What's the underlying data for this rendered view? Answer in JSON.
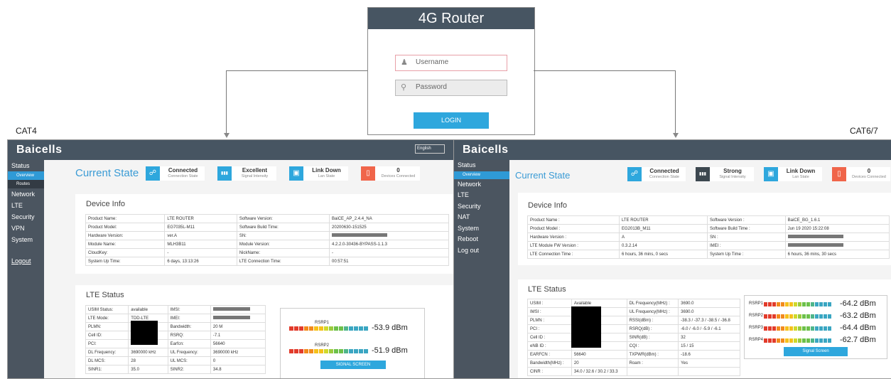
{
  "login": {
    "title": "4G Router",
    "username_placeholder": "Username",
    "password_placeholder": "Password",
    "login_label": "LOGIN"
  },
  "labels": {
    "left": "CAT4",
    "right": "CAT6/7"
  },
  "cat4": {
    "logo": "Baicells",
    "language": "English",
    "nav": [
      {
        "label": "Status",
        "type": "main"
      },
      {
        "label": "Overview",
        "type": "active"
      },
      {
        "label": "Routes",
        "type": "dark"
      },
      {
        "label": "Network",
        "type": "main"
      },
      {
        "label": "LTE",
        "type": "main"
      },
      {
        "label": "Security",
        "type": "main"
      },
      {
        "label": "VPN",
        "type": "main"
      },
      {
        "label": "System",
        "type": "main"
      },
      {
        "label": "",
        "type": "gap"
      },
      {
        "label": "Logout",
        "type": "logout"
      }
    ],
    "title": "Current State",
    "kpis": [
      {
        "value": "Connected",
        "sub": "Connection State",
        "color": "#2ea7dd"
      },
      {
        "value": "Excellent",
        "sub": "Signal Intensity",
        "color": "#2ea7dd"
      },
      {
        "value": "Link Down",
        "sub": "Lan State",
        "color": "#2ea7dd"
      },
      {
        "value": "0",
        "sub": "Devices Connected",
        "color": "#f0654a"
      }
    ],
    "device_info": {
      "heading": "Device Info",
      "rows": [
        [
          "Product Name:",
          "LTE ROUTER",
          "Software Version:",
          "BaiCE_AP_2.4.4_NA"
        ],
        [
          "Product Model:",
          "EG7035L-M11",
          "Software Build Time:",
          "20200630-151525"
        ],
        [
          "Hardware Version:",
          "ver.A",
          "SN:",
          ""
        ],
        [
          "Module Name:",
          "MLH3B11",
          "Module Version:",
          "4.2.2.0-30436-BYPASS-1.1.3"
        ],
        [
          "CloudKey:",
          "-",
          "NickName:",
          "-"
        ],
        [
          "System Up Time:",
          "6 days, 13:13:26",
          "LTE Connection Time:",
          "00:57:51"
        ]
      ]
    },
    "lte_status": {
      "heading": "LTE Status",
      "rows": [
        [
          "USIM Status:",
          "available",
          "IMSI:",
          ""
        ],
        [
          "LTE Mode:",
          "TDD-LTE",
          "IMEI:",
          ""
        ],
        [
          "PLMN:",
          "",
          "Bandwidth:",
          "20 M"
        ],
        [
          "Cell ID:",
          "",
          "RSRQ:",
          "-7.1"
        ],
        [
          "PCI:",
          "",
          "Earfcn:",
          "56640"
        ],
        [
          "DL Frequency:",
          "3690000 kHz",
          "UL Frequency:",
          "3690000 kHz"
        ],
        [
          "DL MCS:",
          "28",
          "UL MCS:",
          "0"
        ],
        [
          "SINR1:",
          "35.0",
          "SINR2:",
          "34.8"
        ]
      ],
      "signals": [
        {
          "label": "RSRP1",
          "value": "-53.9 dBm",
          "level": 1.0
        },
        {
          "label": "RSRP2",
          "value": "-51.9 dBm",
          "level": 1.0
        }
      ],
      "button": "SIGNAL SCREEN"
    }
  },
  "cat6": {
    "logo": "Baicells",
    "nav": [
      {
        "label": "Status",
        "type": "main"
      },
      {
        "label": "Overview",
        "type": "active"
      },
      {
        "label": "Network",
        "type": "main"
      },
      {
        "label": "LTE",
        "type": "main"
      },
      {
        "label": "Security",
        "type": "main"
      },
      {
        "label": "NAT",
        "type": "main"
      },
      {
        "label": "System",
        "type": "main"
      },
      {
        "label": "Reboot",
        "type": "main"
      },
      {
        "label": "Log out",
        "type": "main"
      }
    ],
    "title": "Current State",
    "kpis": [
      {
        "value": "Connected",
        "sub": "Connection State",
        "color": "#2ea7dd"
      },
      {
        "value": "Strong",
        "sub": "Signal Intensity",
        "color": "#3c474f"
      },
      {
        "value": "Link Down",
        "sub": "Lan State",
        "color": "#2ea7dd"
      },
      {
        "value": "0",
        "sub": "Devices Connected",
        "color": "#f0654a"
      }
    ],
    "device_info": {
      "heading": "Device Info",
      "rows": [
        [
          "Product Name :",
          "LTE ROUTER",
          "Software Version :",
          "BaiCE_BG_1.6.1"
        ],
        [
          "Product Model :",
          "EG2013B_M11",
          "Software Build Time :",
          "Jun 19 2020 15:22:08"
        ],
        [
          "Hardware Version :",
          "A",
          "SN :",
          ""
        ],
        [
          "LTE Module FW Version :",
          "0.3.2.14",
          "IMEI :",
          ""
        ],
        [
          "LTE Connection Time :",
          "6 hours, 36 mins, 0 secs",
          "System Up Time :",
          "6 hours, 36 mins, 30 secs"
        ]
      ]
    },
    "lte_status": {
      "heading": "LTE Status",
      "rows": [
        [
          "USIM :",
          "Available",
          "DL Frequency(MHz) :",
          "3690.0"
        ],
        [
          "IMSI :",
          "",
          "UL Frequency(MHz) :",
          "3690.0"
        ],
        [
          "PLMN :",
          "",
          "RSSI(dBm) :",
          "-38.3 / -37.3 / -38.5 / -36.8"
        ],
        [
          "PCI :",
          "",
          "RSRQ(dB) :",
          "-6.0 / -6.0 / -5.9 / -6.1"
        ],
        [
          "Cell ID :",
          "",
          "SINR(dB) :",
          "32"
        ],
        [
          "eNB ID :",
          "",
          "CQI :",
          "15 / 15"
        ],
        [
          "EARFCN :",
          "56640",
          "TXPWR(dBm) :",
          "-18.6"
        ],
        [
          "Bandwidth(MHz) :",
          "20",
          "Roam :",
          "Yes"
        ],
        [
          "CINR :",
          "34.0 / 32.6 / 30.2 / 33.3",
          "",
          ""
        ]
      ],
      "signals": [
        {
          "label": "RSRP1",
          "value": "-64.2 dBm",
          "level": 1.0
        },
        {
          "label": "RSRP2",
          "value": "-63.2 dBm",
          "level": 1.0
        },
        {
          "label": "RSRP3",
          "value": "-64.4 dBm",
          "level": 1.0
        },
        {
          "label": "RSRP4",
          "value": "-62.7 dBm",
          "level": 1.0
        }
      ],
      "button": "Signal Screen"
    }
  }
}
